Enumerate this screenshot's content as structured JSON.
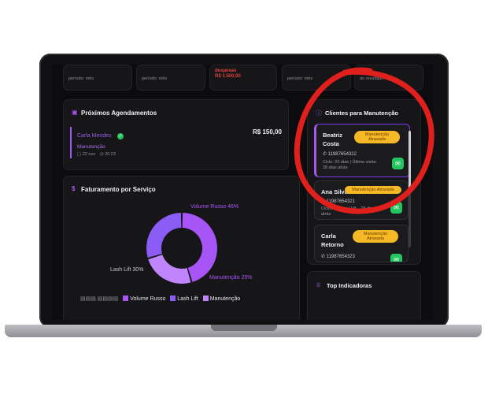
{
  "stats": [
    {
      "label": "período: mês"
    },
    {
      "label": "período: mês"
    },
    {
      "red_top": "despesas",
      "red_value": "R$ 1.500,00"
    },
    {
      "label": "período: mês"
    },
    {
      "label": "do resultado"
    }
  ],
  "appointments": {
    "title": "Próximos Agendamentos",
    "item": {
      "name": "Carla Mendes",
      "service": "Manutenção",
      "date": "22 nov",
      "time": "20:23",
      "price": "R$ 150,00"
    }
  },
  "clients": {
    "title": "Clientes para Manutenção",
    "items": [
      {
        "name": "Beatriz Costa",
        "badge": "Manutenção Atrasada",
        "phone": "11987654322",
        "cycle": "Ciclo: 20 dias | Última visita: 28 dias atrás"
      },
      {
        "name": "Ana Silva",
        "badge": "Manutenção Atrasada",
        "phone": "11987654321",
        "cycle": "Ciclo: 20 dias | Últ... 28 dias atrás"
      },
      {
        "name": "Carla Retorno",
        "badge": "Manutenção Atrasada",
        "phone": "11987654323"
      }
    ]
  },
  "revenue": {
    "title": "Faturamento por Serviço"
  },
  "indicators": {
    "title": "Top Indicadoras"
  },
  "colors": {
    "accent": "#a855f7",
    "danger": "#e0413a",
    "warning": "#f5b925",
    "success": "#22c55e"
  },
  "chart_data": {
    "type": "pie",
    "categories": [
      "Volume Russo",
      "Lash Lift",
      "Manutenção"
    ],
    "values": [
      46,
      30,
      25
    ],
    "labels": [
      "Volume Russo 46%",
      "Lash Lift 30%",
      "Manutenção 25%"
    ],
    "colors": [
      "#a855f7",
      "#8b5cf6",
      "#c084fc"
    ],
    "legend": "bottom"
  }
}
